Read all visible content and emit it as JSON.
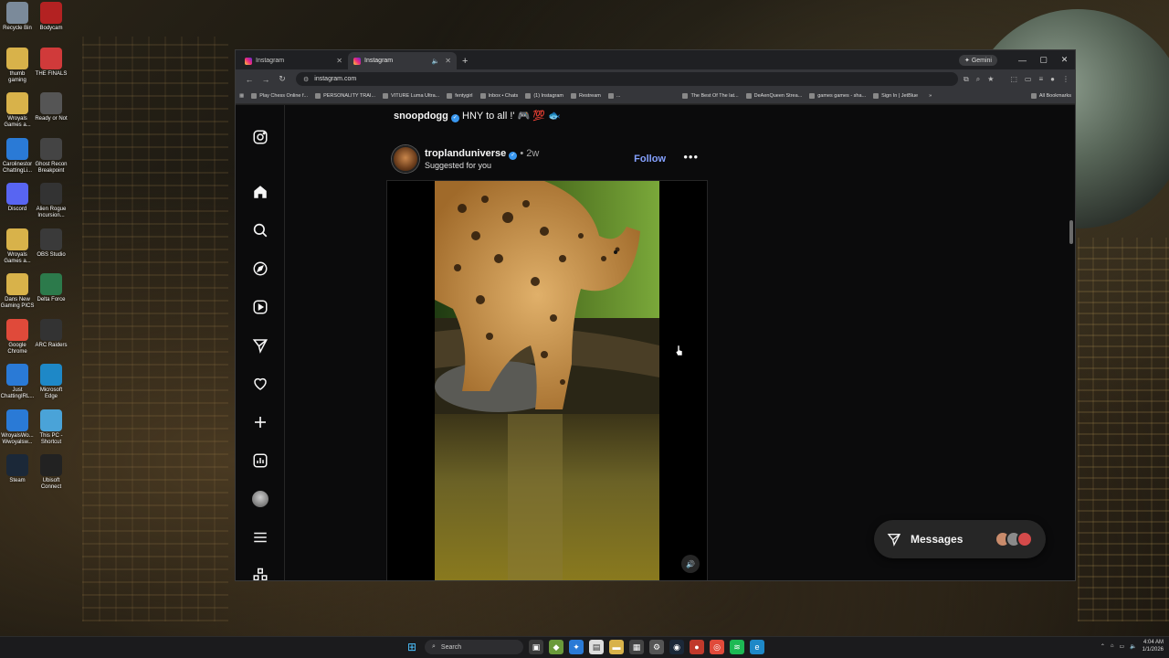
{
  "desktop": {
    "icons": [
      {
        "label": "Recycle Bin",
        "color": "#7b8a9a"
      },
      {
        "label": "Bodycam",
        "color": "#b32222"
      },
      {
        "label": "thumb gaming",
        "color": "#d8b24a"
      },
      {
        "label": "THE FINALS",
        "color": "#d03a3a"
      },
      {
        "label": "Wroyals Games a...",
        "color": "#d8b24a"
      },
      {
        "label": "Ready or Not",
        "color": "#555555"
      },
      {
        "label": "Carolinestor ChattingLi...",
        "color": "#2a7ad6"
      },
      {
        "label": "Ghost Recon Breakpoint",
        "color": "#444444"
      },
      {
        "label": "Discord",
        "color": "#5865f2"
      },
      {
        "label": "Alien Rogue Incursion...",
        "color": "#333333"
      },
      {
        "label": "Wroyals Games a...",
        "color": "#d8b24a"
      },
      {
        "label": "OBS Studio",
        "color": "#3a3a3a"
      },
      {
        "label": "Dans New Gaming PICS",
        "color": "#d8b24a"
      },
      {
        "label": "Delta Force",
        "color": "#2c7a4b"
      },
      {
        "label": "Google Chrome",
        "color": "#e04a3a"
      },
      {
        "label": "ARC Raiders",
        "color": "#333333"
      },
      {
        "label": "Just ChattingIRL...",
        "color": "#2a7ad6"
      },
      {
        "label": "Microsoft Edge",
        "color": "#1e88c7"
      },
      {
        "label": "WroyalsWo... Wwoyalsw...",
        "color": "#2a7ad6"
      },
      {
        "label": "This PC - Shortcut",
        "color": "#4aa3d8"
      },
      {
        "label": "Steam",
        "color": "#1b2838"
      },
      {
        "label": "Ubisoft Connect",
        "color": "#222222"
      }
    ]
  },
  "browser": {
    "tabs": [
      {
        "title": "Instagram",
        "active": false
      },
      {
        "title": "Instagram",
        "active": true
      }
    ],
    "gemini_label": "Gemini",
    "url": "instagram.com",
    "bookmarks": [
      "Play Chess Online f...",
      "PERSONALITY TRAI...",
      "VITURE Luma Ultra...",
      "fentygirl",
      "Inbox • Chats",
      "(1) Instagram",
      "Restream",
      "...",
      "The Best Of The lat...",
      "DeAenQueen Strea...",
      "games games - sha...",
      "Sign In | JetBlue"
    ],
    "all_bookmarks": "All Bookmarks"
  },
  "instagram": {
    "prev_caption": {
      "user": "snoopdogg",
      "text": "HNY to all !' 🎮 💯 🐟"
    },
    "post": {
      "username": "troplanduniverse",
      "time": "2w",
      "subtitle": "Suggested for you",
      "follow_label": "Follow",
      "more_label": "•••"
    },
    "messages_label": "Messages",
    "messages_avatar_colors": [
      "#c98b6b",
      "#8a8a8a",
      "#d44a4a"
    ]
  },
  "taskbar": {
    "search_placeholder": "Search",
    "time": "4:04 AM",
    "date": "1/1/2026"
  }
}
